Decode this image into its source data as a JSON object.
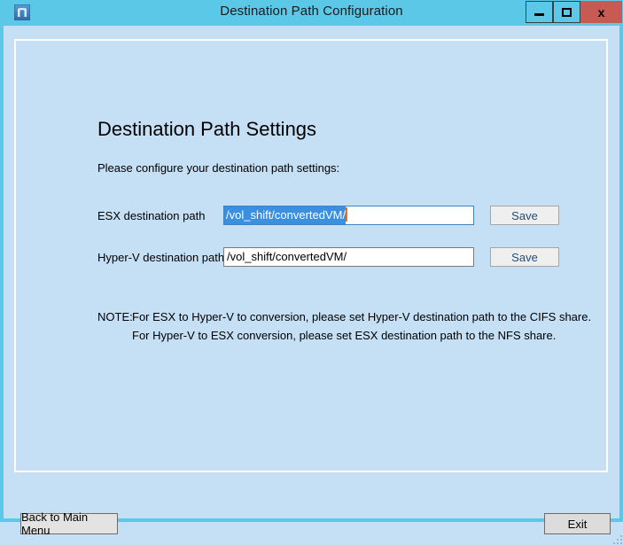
{
  "window": {
    "title": "Destination Path Configuration",
    "icon": "app-icon",
    "controls": {
      "minimize_label": "",
      "maximize_label": "",
      "close_label": "x"
    },
    "colors": {
      "titlebar": "#5bc8e8",
      "close_button": "#c75b53",
      "panel_background": "#c5dff5",
      "panel_border": "#ffffff",
      "focus_border": "#3f83c4",
      "selection": "#3a8fe0",
      "caret": "#d8762a",
      "save_text": "#1f4e79"
    }
  },
  "main": {
    "heading": "Destination Path Settings",
    "subheading": "Please configure your destination path settings:",
    "fields": [
      {
        "label": "ESX destination path",
        "value": "/vol_shift/convertedVM/",
        "placeholder": "",
        "focused": true,
        "selected": true,
        "save_label": "Save"
      },
      {
        "label": "Hyper-V destination path",
        "value": "/vol_shift/convertedVM/",
        "placeholder": "",
        "focused": false,
        "selected": false,
        "save_label": "Save"
      }
    ],
    "note": {
      "prefix": "NOTE:",
      "line1": "For ESX to Hyper-V to conversion, please set Hyper-V destination path to the CIFS share.",
      "line2": "For Hyper-V to ESX conversion, please set ESX destination path to the NFS share."
    }
  },
  "footer": {
    "back_label": "Back to Main Menu",
    "exit_label": "Exit"
  }
}
